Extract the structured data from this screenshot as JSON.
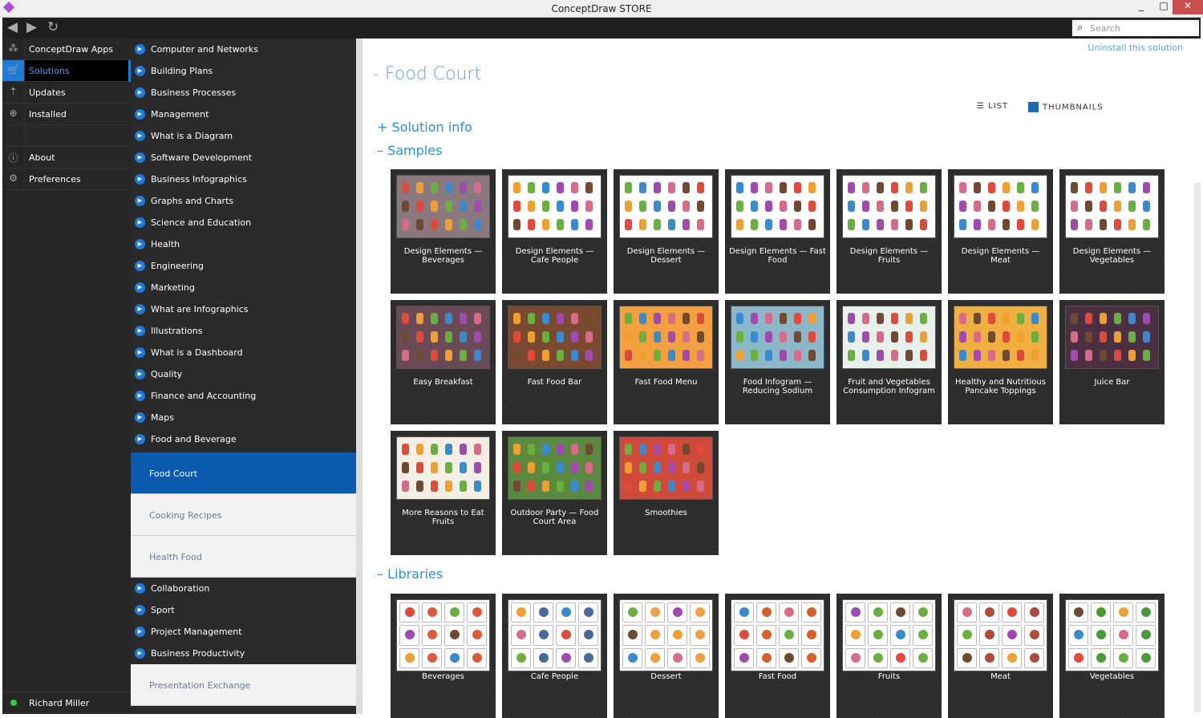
{
  "window": {
    "title": "ConceptDraw STORE",
    "minimize": "_",
    "maximize": "□",
    "close": "✕"
  },
  "toolbar": {
    "back": "◀",
    "forward": "▶",
    "refresh": "↻",
    "search_placeholder": "Search"
  },
  "left_nav": [
    {
      "label": "ConceptDraw Apps",
      "icon": "apps-icon",
      "glyph": "⁂"
    },
    {
      "label": "Solutions",
      "icon": "cart-icon",
      "glyph": "🛒",
      "active": true
    },
    {
      "label": "Updates",
      "icon": "updates-icon",
      "glyph": "⇡"
    },
    {
      "label": "Installed",
      "icon": "download-icon",
      "glyph": "⊕"
    },
    {
      "label": "",
      "icon": "",
      "glyph": ""
    },
    {
      "label": "About",
      "icon": "info-icon",
      "glyph": "ⓘ"
    },
    {
      "label": "Preferences",
      "icon": "gear-icon",
      "glyph": "⚙"
    }
  ],
  "user": {
    "name": "Richard Miller",
    "status_color": "#2ecc40"
  },
  "categories_top": [
    "Computer and Networks",
    "Building Plans",
    "Business Processes",
    "Management",
    "What is a Diagram",
    "Software Development",
    "Business Infographics",
    "Graphs and Charts",
    "Science and Education",
    "Health",
    "Engineering",
    "Marketing",
    "What are Infographics",
    "Illustrations",
    "What is a Dashboard",
    "Quality",
    "Finance and Accounting",
    "Maps",
    "Food and Beverage"
  ],
  "subitems": [
    {
      "label": "Food Court",
      "selected": true
    },
    {
      "label": "Cooking Recipes"
    },
    {
      "label": "Health Food"
    }
  ],
  "categories_bottom": [
    "Collaboration",
    "Sport",
    "Project Management",
    "Business Productivity"
  ],
  "subitems_bottom": [
    {
      "label": "Presentation Exchange"
    }
  ],
  "main": {
    "uninstall": "Uninstall this solution",
    "title": "- Food Court",
    "view_list": "LIST",
    "view_thumbnails": "THUMBNAILS",
    "solution_info": "+ Solution info",
    "samples_heading": "– Samples",
    "libraries_heading": "– Libraries",
    "samples": [
      {
        "label": "Design Elements — Beverages",
        "bg": "#8a7a80"
      },
      {
        "label": "Design Elements — Cafe People",
        "bg": "#ffffff"
      },
      {
        "label": "Design Elements — Dessert",
        "bg": "#ffffff"
      },
      {
        "label": "Design Elements — Fast Food",
        "bg": "#ffffff"
      },
      {
        "label": "Design Elements — Fruits",
        "bg": "#ffffff"
      },
      {
        "label": "Design Elements — Meat",
        "bg": "#ffffff"
      },
      {
        "label": "Design Elements — Vegetables",
        "bg": "#ffffff"
      },
      {
        "label": "Easy Breakfast",
        "bg": "#6a4a55"
      },
      {
        "label": "Fast Food Bar",
        "bg": "#7a4a30"
      },
      {
        "label": "Fast Food Menu",
        "bg": "#f2a040"
      },
      {
        "label": "Food Infogram — Reducing Sodium",
        "bg": "#8ab8c8"
      },
      {
        "label": "Fruit and Vegetables Consumption Infogram",
        "bg": "#e8f0ec"
      },
      {
        "label": "Healthy and Nutritious Pancake Toppings",
        "bg": "#f0b040"
      },
      {
        "label": "Juice Bar",
        "bg": "#4a3040"
      },
      {
        "label": "More Reasons to Eat Fruits",
        "bg": "#f4efe4"
      },
      {
        "label": "Outdoor Party — Food Court Area",
        "bg": "#5a8a40"
      },
      {
        "label": "Smoothies",
        "bg": "#d04a3a"
      }
    ],
    "libraries": [
      {
        "label": "Beverages",
        "accent": "#e05a3a"
      },
      {
        "label": "Cafe People",
        "accent": "#4a6a9a"
      },
      {
        "label": "Dessert",
        "accent": "#f0a040"
      },
      {
        "label": "Fast Food",
        "accent": "#d8602a"
      },
      {
        "label": "Fruits",
        "accent": "#6ab040"
      },
      {
        "label": "Meat",
        "accent": "#b04a3a"
      },
      {
        "label": "Vegetables",
        "accent": "#4a9a3a"
      }
    ]
  },
  "colors": {
    "accent": "#1e7bd8",
    "heading": "#2e8fd8",
    "selected_sub": "#0a5bb0"
  }
}
